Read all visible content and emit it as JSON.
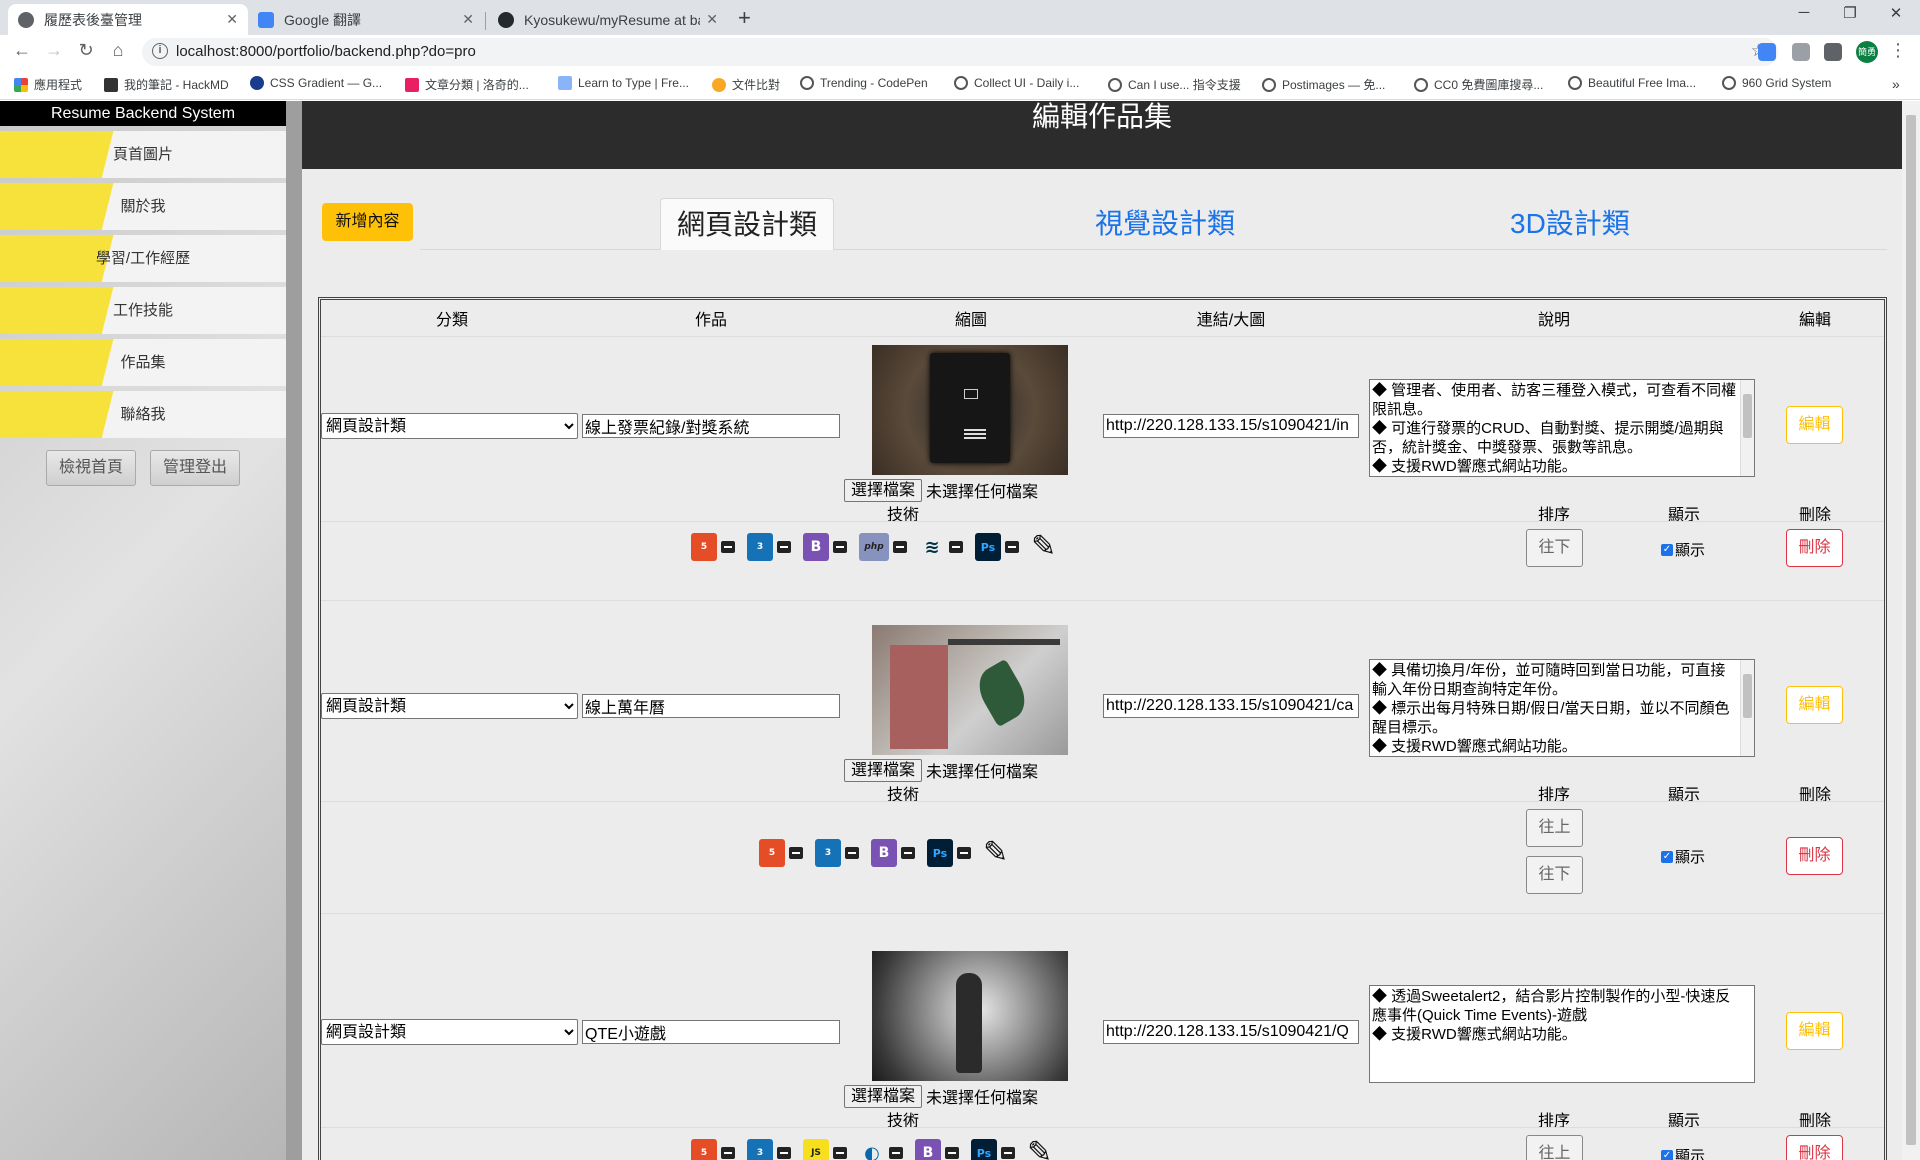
{
  "browser": {
    "tabs": [
      {
        "title": "履歷表後臺管理",
        "icon": "globe-icon"
      },
      {
        "title": "Google 翻譯",
        "icon": "google-translate-icon"
      },
      {
        "title": "Kyosukewu/myResume at back",
        "icon": "github-icon"
      }
    ],
    "url": "localhost:8000/portfolio/backend.php?do=pro",
    "bookmarks": [
      "應用程式",
      "我的筆記 - HackMD",
      "CSS Gradient — G...",
      "文章分類 | 洛奇的...",
      "Learn to Type | Fre...",
      "文件比對",
      "Trending - CodePen",
      "Collect UI - Daily i...",
      "Can I use... 指令支援",
      "Postimages — 免...",
      "CC0 免費圖庫搜尋...",
      "Beautiful Free Ima...",
      "960 Grid System"
    ],
    "profile": "簡勇"
  },
  "sidebar": {
    "title": "Resume Backend System",
    "items": [
      "頁首圖片",
      "關於我",
      "學習/工作經歷",
      "工作技能",
      "作品集",
      "聯絡我"
    ],
    "buttons": [
      "檢視首頁",
      "管理登出"
    ]
  },
  "main": {
    "title": "編輯作品集",
    "add_button": "新增內容",
    "tabs": [
      "網頁設計類",
      "視覺設計類",
      "3D設計類"
    ],
    "headers": [
      "分類",
      "作品",
      "縮圖",
      "連結/大圖",
      "說明",
      "編輯"
    ],
    "sub_labels": {
      "tech": "技術",
      "order": "排序",
      "show": "顯示",
      "delete": "刪除"
    },
    "file_button": "選擇檔案",
    "file_status": "未選擇任何檔案",
    "edit_label": "編輯",
    "delete_label": "刪除",
    "up_label": "往上",
    "down_label": "往下",
    "show_label": "顯示"
  },
  "rows": [
    {
      "category": "網頁設計類",
      "title": "線上發票紀錄/對獎系統",
      "link": "http://220.128.133.15/s1090421/in",
      "desc": "◆ 管理者、使用者、訪客三種登入模式，可查看不同權限訊息。\n◆ 可進行發票的CRUD、自動對獎、提示開獎/過期與否，統計獎金、中獎發票、張數等訊息。\n◆ 支援RWD響應式網站功能。",
      "techs": [
        "HTML5",
        "CSS3",
        "Bootstrap",
        "PHP",
        "MariaDB",
        "Photoshop"
      ],
      "show": true
    },
    {
      "category": "網頁設計類",
      "title": "線上萬年曆",
      "link": "http://220.128.133.15/s1090421/ca",
      "desc": "◆ 具備切換月/年份，並可隨時回到當日功能，可直接輸入年份日期查詢特定年份。\n◆ 標示出每月特殊日期/假日/當天日期，並以不同顏色醒目標示。\n◆ 支援RWD響應式網站功能。",
      "techs": [
        "HTML5",
        "CSS3",
        "Bootstrap",
        "Photoshop"
      ],
      "show": true
    },
    {
      "category": "網頁設計類",
      "title": "QTE小遊戲",
      "link": "http://220.128.133.15/s1090421/Q",
      "desc": "◆ 透過Sweetalert2，結合影片控制製作的小型-快速反應事件(Quick Time Events)-遊戲\n◆ 支援RWD響應式網站功能。",
      "techs": [
        "HTML5",
        "CSS3",
        "JavaScript",
        "jQuery",
        "Bootstrap",
        "Photoshop"
      ],
      "show": true
    }
  ],
  "colors": {
    "sidebar_accent": "#f7e23c",
    "add_button": "#ffc107",
    "edit_button": "#ffc107",
    "delete_button": "#dc3545",
    "tab_link": "#1a73e8",
    "header_bar": "#2c2c2c"
  }
}
